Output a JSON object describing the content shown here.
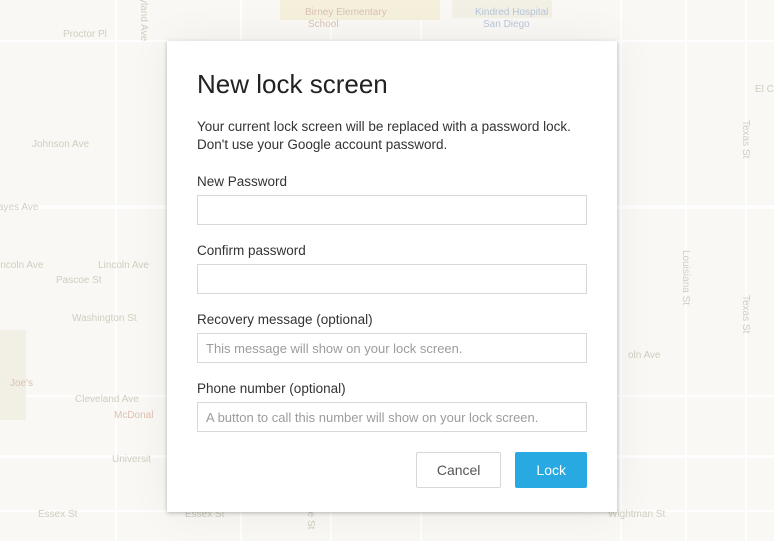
{
  "dialog": {
    "title": "New lock screen",
    "description": "Your current lock screen will be replaced with a password lock. Don't use your Google account password.",
    "fields": {
      "new_password": {
        "label": "New Password",
        "value": ""
      },
      "confirm_password": {
        "label": "Confirm password",
        "value": ""
      },
      "recovery_message": {
        "label": "Recovery message (optional)",
        "placeholder": "This message will show on your lock screen.",
        "value": ""
      },
      "phone_number": {
        "label": "Phone number (optional)",
        "placeholder": "A button to call this number will show on your lock screen.",
        "value": ""
      }
    },
    "buttons": {
      "cancel": "Cancel",
      "lock": "Lock"
    }
  },
  "map": {
    "streets": {
      "proctor_pl": "Proctor Pl",
      "johnson_ave": "Johnson Ave",
      "ayes_ave": "ayes Ave",
      "lincoln_ave_1": "Lincoln Ave",
      "lincoln_ave_2": "incoln Ave",
      "pascoe_st": "Pascoe St",
      "washington_st": "Washington St",
      "joes": "Joe's",
      "cleveland_ave": "Cleveland Ave",
      "mcdonal": "McDonal",
      "university": "Universit",
      "essex_st_1": "Essex St",
      "essex_st_2": "Essex St",
      "centre_st": "ntre St",
      "yland_ave": "yland Ave",
      "birney": "Birney Elementary",
      "school": "School",
      "kindred": "Kindred Hospital",
      "sandiego": "San Diego",
      "el_ca": "El Ca",
      "texas_st_1": "Texas St",
      "texas_st_2": "Texas St",
      "louisiana_st": "Louisiana St",
      "oln_ave": "oln Ave",
      "wightman_st": "Wightman St"
    }
  }
}
